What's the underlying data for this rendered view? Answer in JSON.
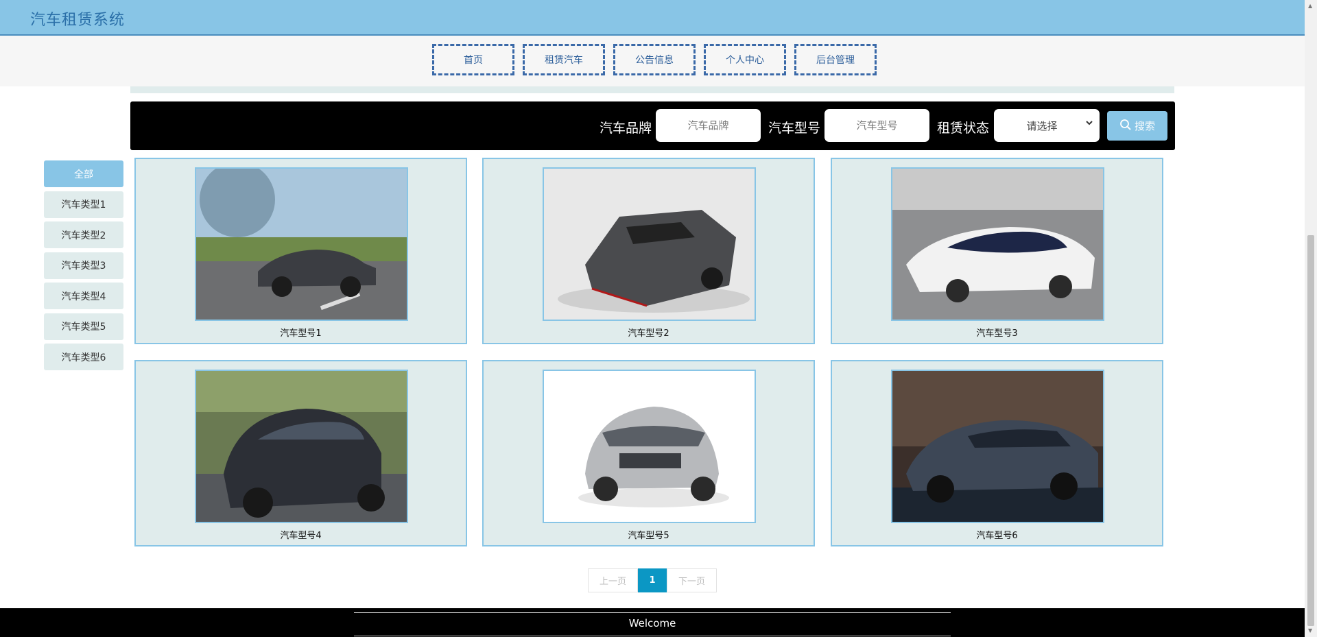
{
  "header": {
    "title": "汽车租赁系统"
  },
  "nav": {
    "items": [
      {
        "label": "首页"
      },
      {
        "label": "租赁汽车"
      },
      {
        "label": "公告信息"
      },
      {
        "label": "个人中心"
      },
      {
        "label": "后台管理"
      }
    ]
  },
  "search": {
    "brand_label": "汽车品牌",
    "brand_placeholder": "汽车品牌",
    "model_label": "汽车型号",
    "model_placeholder": "汽车型号",
    "status_label": "租赁状态",
    "status_value": "请选择",
    "button_label": "搜索"
  },
  "sidebar": {
    "items": [
      {
        "label": "全部",
        "active": true
      },
      {
        "label": "汽车类型1"
      },
      {
        "label": "汽车类型2"
      },
      {
        "label": "汽车类型3"
      },
      {
        "label": "汽车类型4"
      },
      {
        "label": "汽车类型5"
      },
      {
        "label": "汽车类型6"
      }
    ]
  },
  "cars": [
    {
      "name": "汽车型号1"
    },
    {
      "name": "汽车型号2"
    },
    {
      "name": "汽车型号3"
    },
    {
      "name": "汽车型号4"
    },
    {
      "name": "汽车型号5"
    },
    {
      "name": "汽车型号6"
    }
  ],
  "pagination": {
    "prev": "上一页",
    "current": "1",
    "next": "下一页"
  },
  "footer": {
    "text": "Welcome"
  },
  "colors": {
    "accent": "#88c5e6",
    "nav_border": "#3a69a8",
    "card_bg": "#e0ecec",
    "page_active": "#0b97c4"
  }
}
